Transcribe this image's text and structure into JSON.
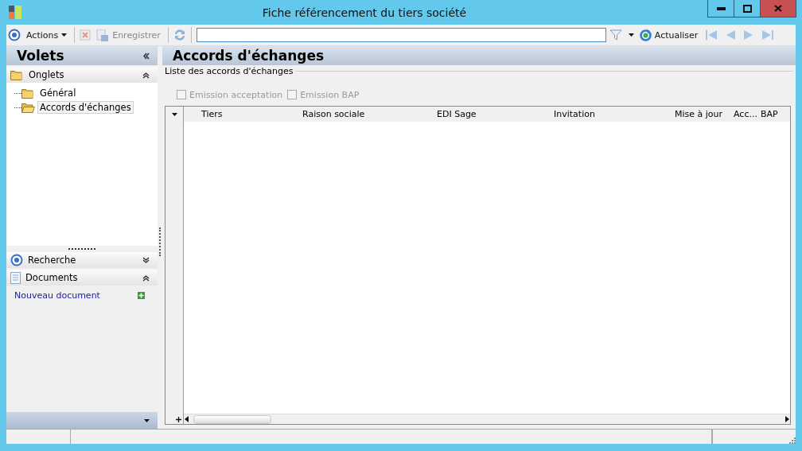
{
  "window": {
    "title": "Fiche référencement du tiers société"
  },
  "toolbar": {
    "actions": "Actions",
    "save": {
      "label": "Enregistrer",
      "disabled": true
    },
    "refresh": "Actualiser"
  },
  "sidebar": {
    "title": "Volets",
    "sections": [
      {
        "kind": "tree",
        "label": "Onglets",
        "expanded": true,
        "items": [
          {
            "label": "Général",
            "selected": false
          },
          {
            "label": "Accords d'échanges",
            "selected": true
          }
        ]
      },
      {
        "kind": "search",
        "label": "Recherche",
        "expanded": false
      },
      {
        "kind": "documents",
        "label": "Documents",
        "expanded": true,
        "link": "Nouveau document"
      }
    ]
  },
  "content": {
    "title": "Accords d'échanges",
    "group_label": "Liste des accords d'échanges",
    "checkboxes": [
      {
        "label": "Emission acceptation",
        "checked": false,
        "disabled": true
      },
      {
        "label": "Emission BAP",
        "checked": false,
        "disabled": true
      }
    ],
    "table": {
      "columns": [
        "Tiers",
        "Raison sociale",
        "EDI Sage",
        "Invitation",
        "Mise à jour",
        "Acc...",
        "BAP"
      ]
    }
  }
}
